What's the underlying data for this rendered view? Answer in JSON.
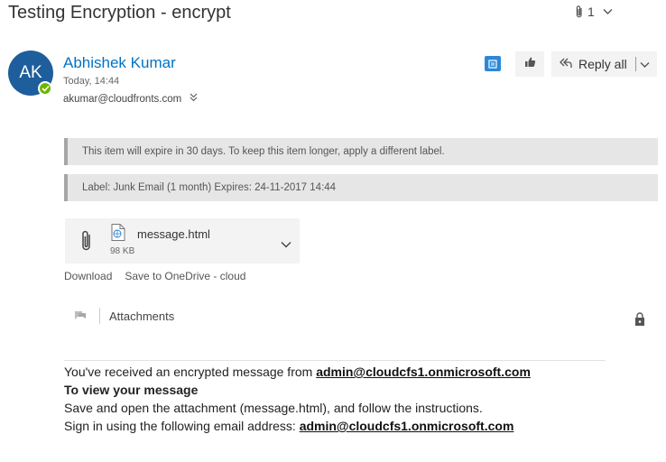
{
  "subject": "Testing Encryption - encrypt",
  "attachment_count": "1",
  "sender": {
    "initials": "AK",
    "name": "Abhishek Kumar",
    "date": "Today, 14:44",
    "to": "akumar@cloudfronts.com"
  },
  "toolbar": {
    "reply_all_label": "Reply all"
  },
  "notices": {
    "expire": "This item will expire in 30 days. To keep this item longer, apply a different label.",
    "label": "Label: Junk Email (1 month) Expires: 24-11-2017 14:44"
  },
  "attachment": {
    "name": "message.html",
    "size": "98 KB",
    "download_label": "Download",
    "save_label": "Save to OneDrive - cloud"
  },
  "attachments_section": {
    "label": "Attachments"
  },
  "message": {
    "line1_prefix": "You've received an encrypted message from ",
    "line1_link": "admin@cloudcfs1.onmicrosoft.com",
    "line2": "To view your message",
    "line3": "Save and open the attachment (message.html), and follow the instructions.",
    "line4_prefix": "Sign in using the following email address: ",
    "line4_link": "admin@cloudcfs1.onmicrosoft.com"
  },
  "colors": {
    "accent": "#0072c6",
    "avatar": "#1f5e9c",
    "presence": "#6bb700"
  }
}
